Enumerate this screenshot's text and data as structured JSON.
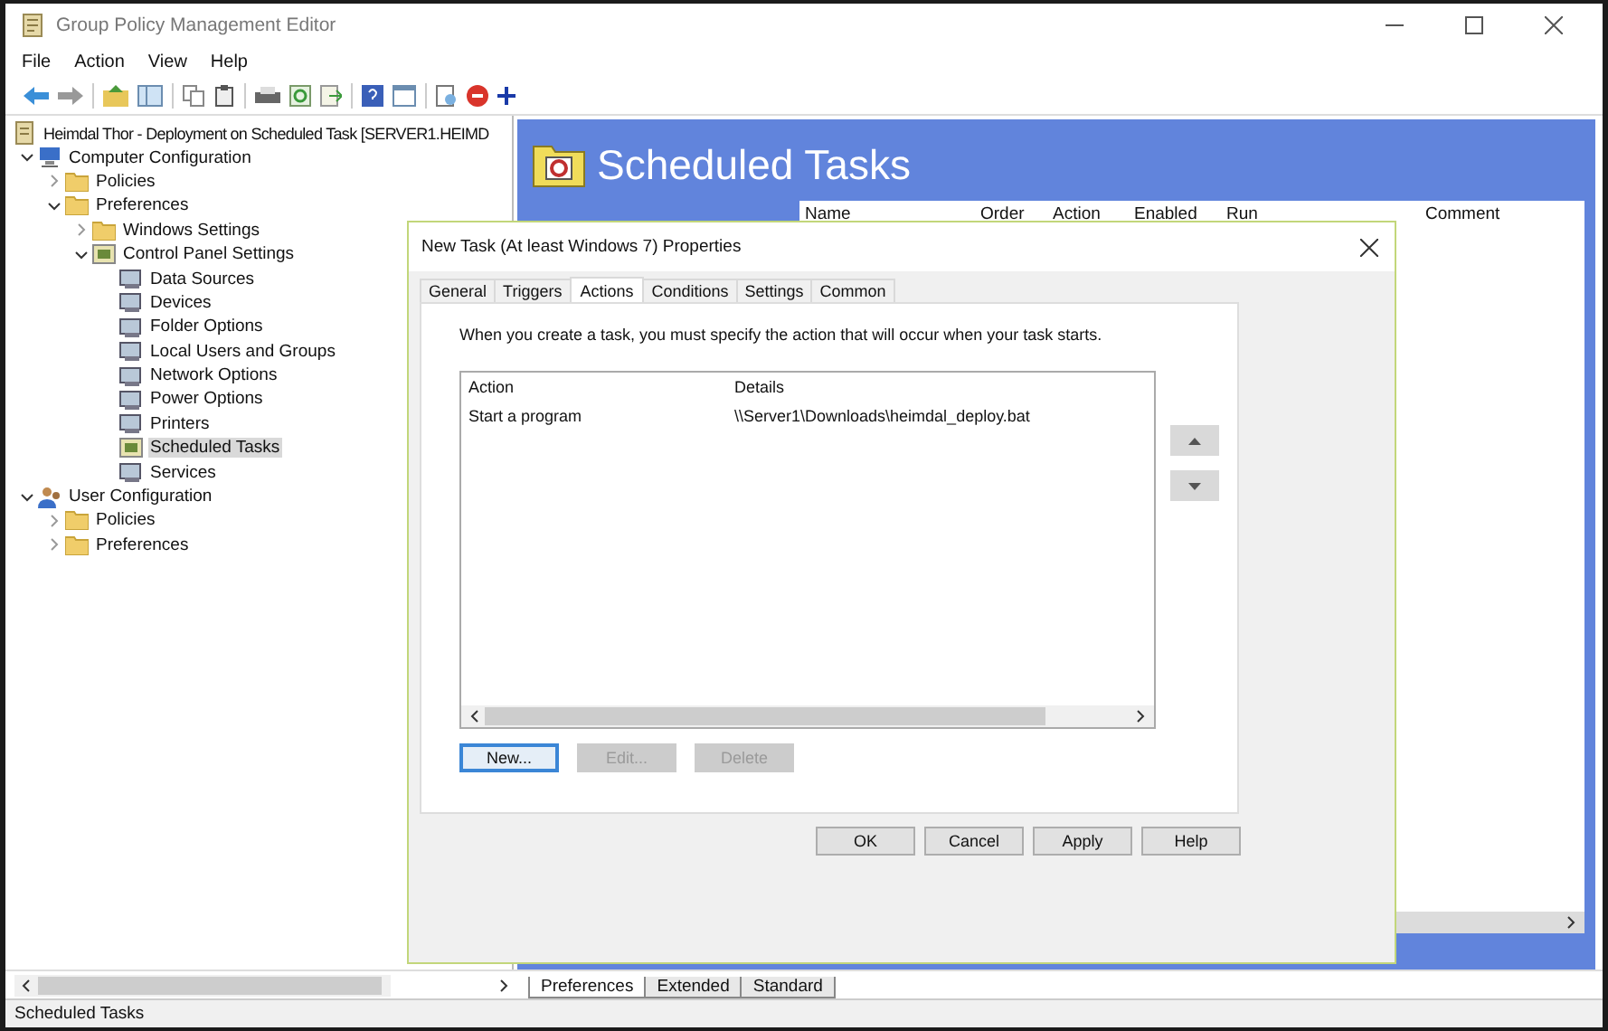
{
  "window": {
    "title": "Group Policy Management Editor"
  },
  "menu": [
    "File",
    "Action",
    "View",
    "Help"
  ],
  "tree": {
    "root": {
      "label": "Heimdal Thor - Deployment on Scheduled Task [SERVER1.HEIMD"
    },
    "items": [
      {
        "label": "Computer Configuration",
        "kind": "computer",
        "expanded": true,
        "selected": false,
        "children": [
          {
            "label": "Policies",
            "kind": "folder",
            "expanded": false,
            "selected": false
          },
          {
            "label": "Preferences",
            "kind": "folder",
            "expanded": true,
            "selected": false,
            "children": [
              {
                "label": "Windows Settings",
                "kind": "folder",
                "expanded": false,
                "selected": false
              },
              {
                "label": "Control Panel Settings",
                "kind": "panel",
                "expanded": true,
                "selected": false,
                "children": [
                  {
                    "label": "Data Sources",
                    "kind": "setting",
                    "selected": false
                  },
                  {
                    "label": "Devices",
                    "kind": "setting",
                    "selected": false
                  },
                  {
                    "label": "Folder Options",
                    "kind": "setting",
                    "selected": false
                  },
                  {
                    "label": "Local Users and Groups",
                    "kind": "setting",
                    "selected": false
                  },
                  {
                    "label": "Network Options",
                    "kind": "setting",
                    "selected": false
                  },
                  {
                    "label": "Power Options",
                    "kind": "setting",
                    "selected": false
                  },
                  {
                    "label": "Printers",
                    "kind": "setting",
                    "selected": false
                  },
                  {
                    "label": "Scheduled Tasks",
                    "kind": "panel",
                    "selected": true
                  },
                  {
                    "label": "Services",
                    "kind": "setting",
                    "selected": false
                  }
                ]
              }
            ]
          }
        ]
      },
      {
        "label": "User Configuration",
        "kind": "user",
        "expanded": true,
        "selected": false,
        "children": [
          {
            "label": "Policies",
            "kind": "folder",
            "expanded": false,
            "selected": false
          },
          {
            "label": "Preferences",
            "kind": "folder",
            "expanded": false,
            "selected": false
          }
        ]
      }
    ]
  },
  "pane": {
    "title": "Scheduled Tasks",
    "columns": [
      "Name",
      "Order",
      "Action",
      "Enabled",
      "Run",
      "Comment"
    ]
  },
  "dialog": {
    "title": "New Task (At least Windows 7) Properties",
    "tabs": [
      {
        "label": "General",
        "selected": false
      },
      {
        "label": "Triggers",
        "selected": false
      },
      {
        "label": "Actions",
        "selected": true
      },
      {
        "label": "Conditions",
        "selected": false
      },
      {
        "label": "Settings",
        "selected": false
      },
      {
        "label": "Common",
        "selected": false
      }
    ],
    "description": "When you create a task, you must specify the action that will occur when your task starts.",
    "table": {
      "columns": [
        "Action",
        "Details"
      ],
      "rows": [
        [
          "Start a program",
          "\\\\Server1\\Downloads\\heimdal_deploy.bat"
        ]
      ]
    },
    "list_buttons": [
      {
        "label": "New...",
        "disabled": false
      },
      {
        "label": "Edit...",
        "disabled": true
      },
      {
        "label": "Delete",
        "disabled": true
      }
    ],
    "buttons": [
      "OK",
      "Cancel",
      "Apply",
      "Help"
    ]
  },
  "bottom_tabs": [
    {
      "label": "Preferences",
      "selected": true
    },
    {
      "label": "Extended",
      "selected": false
    },
    {
      "label": "Standard",
      "selected": false
    }
  ],
  "status_bar": "Scheduled Tasks"
}
